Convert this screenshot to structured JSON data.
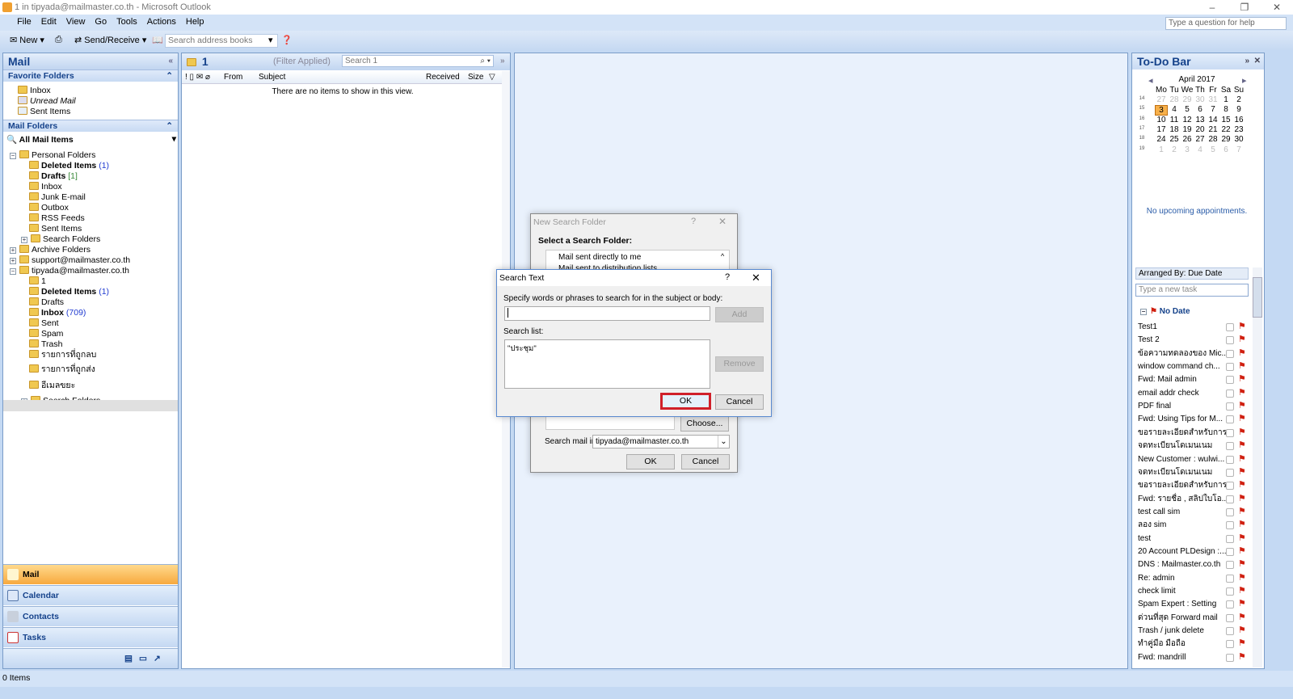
{
  "window": {
    "title": "1 in tipyada@mailmaster.co.th - Microsoft Outlook",
    "help_placeholder": "Type a question for help"
  },
  "menu": [
    "File",
    "Edit",
    "View",
    "Go",
    "Tools",
    "Actions",
    "Help"
  ],
  "toolbar": {
    "new": "New",
    "send_receive": "Send/Receive",
    "address_search_placeholder": "Search address books"
  },
  "nav": {
    "title": "Mail",
    "favorites_title": "Favorite Folders",
    "favorites": [
      "Inbox",
      "Unread Mail",
      "Sent Items"
    ],
    "mail_folders_title": "Mail Folders",
    "all_mail_items": "All Mail Items",
    "tree": [
      {
        "label": "Personal Folders",
        "indent": 0,
        "exp": "−"
      },
      {
        "label": "Deleted Items",
        "indent": 1,
        "bold": true,
        "count": "(1)"
      },
      {
        "label": "Drafts",
        "indent": 1,
        "bold": true,
        "count": "[1]",
        "green": true
      },
      {
        "label": "Inbox",
        "indent": 1
      },
      {
        "label": "Junk E-mail",
        "indent": 1
      },
      {
        "label": "Outbox",
        "indent": 1
      },
      {
        "label": "RSS Feeds",
        "indent": 1
      },
      {
        "label": "Sent Items",
        "indent": 1
      },
      {
        "label": "Search Folders",
        "indent": 1,
        "exp": "+"
      },
      {
        "label": "Archive Folders",
        "indent": 0,
        "exp": "+"
      },
      {
        "label": "support@mailmaster.co.th",
        "indent": 0,
        "exp": "+"
      },
      {
        "label": "tipyada@mailmaster.co.th",
        "indent": 0,
        "exp": "−"
      },
      {
        "label": "1",
        "indent": 1
      },
      {
        "label": "Deleted Items",
        "indent": 1,
        "bold": true,
        "count": "(1)"
      },
      {
        "label": "Drafts",
        "indent": 1
      },
      {
        "label": "Inbox",
        "indent": 1,
        "bold": true,
        "count": "(709)"
      },
      {
        "label": "Sent",
        "indent": 1
      },
      {
        "label": "Spam",
        "indent": 1
      },
      {
        "label": "Trash",
        "indent": 1
      },
      {
        "label": "รายการที่ถูกลบ",
        "indent": 1
      },
      {
        "label": "รายการที่ถูกส่ง",
        "indent": 1
      },
      {
        "label": "อีเมลขยะ",
        "indent": 1
      },
      {
        "label": "Search Folders",
        "indent": 1,
        "exp": "+"
      }
    ],
    "buttons": [
      "Mail",
      "Calendar",
      "Contacts",
      "Tasks"
    ]
  },
  "list": {
    "folder": "1",
    "filter": "(Filter Applied)",
    "search_placeholder": "Search 1",
    "columns": [
      "From",
      "Subject",
      "Received",
      "Size"
    ],
    "empty": "There are no items to show in this view."
  },
  "status": "0 Items",
  "new_search_folder": {
    "title": "New Search Folder",
    "heading": "Select a Search Folder:",
    "options": [
      "Mail sent directly to me",
      "Mail sent to distribution lists"
    ],
    "choose": "Choose...",
    "search_mail_in_label": "Search mail in:",
    "search_mail_in": "tipyada@mailmaster.co.th",
    "ok": "OK",
    "cancel": "Cancel"
  },
  "search_text": {
    "title": "Search Text",
    "prompt": "Specify words or phrases to search for in the subject or body:",
    "input": "",
    "add": "Add",
    "list_label": "Search list:",
    "list": [
      "\"ประชุม\""
    ],
    "remove": "Remove",
    "ok": "OK",
    "cancel": "Cancel"
  },
  "todo": {
    "title": "To-Do Bar",
    "month": "April 2017",
    "days": [
      "Mo",
      "Tu",
      "We",
      "Th",
      "Fr",
      "Sa",
      "Su"
    ],
    "weeks": [
      {
        "wk": "14",
        "d": [
          "27",
          "28",
          "29",
          "30",
          "31",
          "1",
          "2"
        ]
      },
      {
        "wk": "15",
        "d": [
          "3",
          "4",
          "5",
          "6",
          "7",
          "8",
          "9"
        ]
      },
      {
        "wk": "16",
        "d": [
          "10",
          "11",
          "12",
          "13",
          "14",
          "15",
          "16"
        ]
      },
      {
        "wk": "17",
        "d": [
          "17",
          "18",
          "19",
          "20",
          "21",
          "22",
          "23"
        ]
      },
      {
        "wk": "18",
        "d": [
          "24",
          "25",
          "26",
          "27",
          "28",
          "29",
          "30"
        ]
      },
      {
        "wk": "19",
        "d": [
          "1",
          "2",
          "3",
          "4",
          "5",
          "6",
          "7"
        ]
      }
    ],
    "today": "3",
    "no_appointments": "No upcoming appointments.",
    "arranged_by": "Arranged By: Due Date",
    "new_task_placeholder": "Type a new task",
    "group": "No Date",
    "tasks": [
      "Test1",
      "Test 2",
      "ข้อความทดลองของ Mic...",
      "window command ch...",
      "Fwd: Mail admin",
      "email addr check",
      "PDF final",
      "Fwd: Using Tips for M...",
      "ขอรายละเอียดสำหรับการ...",
      "จดทะเบียนโดเมนเนม",
      "New Customer : wulwi...",
      "จดทะเบียนโดเมนเนม",
      "ขอรายละเอียดสำหรับการ...",
      "Fwd: รายชื่อ , สลิปใบโอ...",
      "test call sim",
      "ลอง sim",
      "test",
      "20 Account PLDesign :...",
      "DNS : Mailmaster.co.th",
      "Re: admin",
      "check limit",
      "Spam Expert : Setting",
      "ด่วนที่สุด Forward mail",
      "Trash / junk delete",
      "ทำคู่มือ มือถือ",
      "Fwd: mandrill"
    ]
  },
  "colors": {
    "accent": "#15428b",
    "active_nav": "#f7a93e",
    "highlight": "#d0202a"
  }
}
